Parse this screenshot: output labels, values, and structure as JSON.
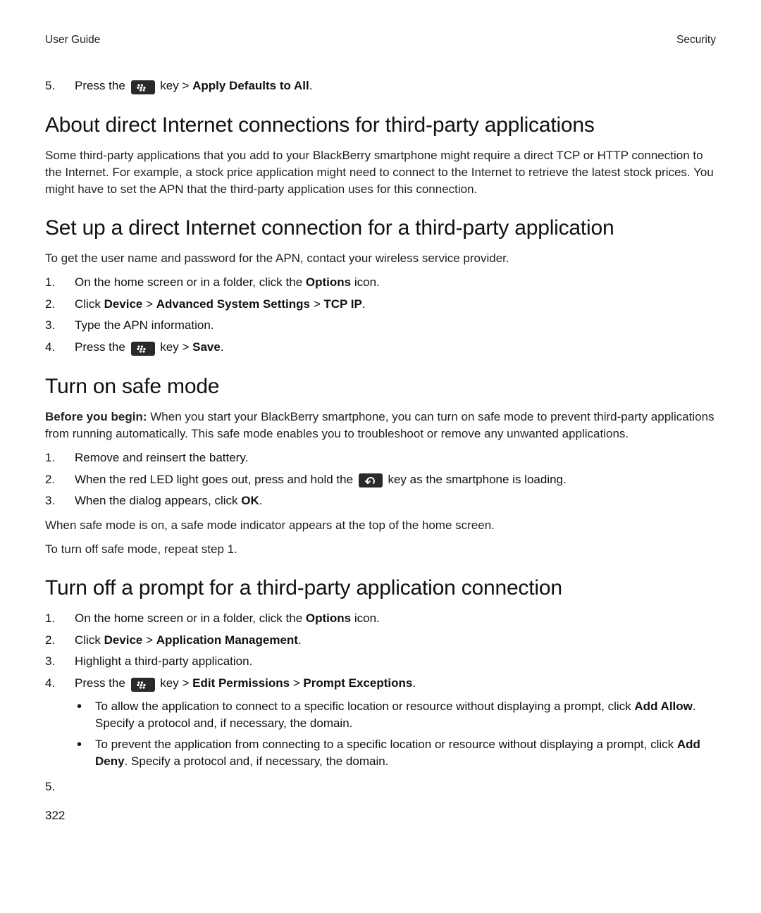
{
  "header": {
    "left": "User Guide",
    "right": "Security"
  },
  "top_step": {
    "num": "5.",
    "pre": "Press the ",
    "post_key": " key > ",
    "bold_tail": "Apply Defaults to All",
    "period": "."
  },
  "sec1": {
    "title": "About direct Internet connections for third-party applications",
    "p": "Some third-party applications that you add to your BlackBerry smartphone might require a direct TCP or HTTP connection to the Internet. For example, a stock price application might need to connect to the Internet to retrieve the latest stock prices. You might have to set the APN that the third-party application uses for this connection."
  },
  "sec2": {
    "title": "Set up a direct Internet connection for a third-party application",
    "intro": "To get the user name and password for the APN, contact your wireless service provider.",
    "steps": [
      {
        "num": "1.",
        "parts": [
          {
            "t": "On the home screen or in a folder, click the "
          },
          {
            "t": "Options",
            "bold": true
          },
          {
            "t": " icon."
          }
        ]
      },
      {
        "num": "2.",
        "parts": [
          {
            "t": "Click "
          },
          {
            "t": "Device",
            "bold": true
          },
          {
            "t": " > "
          },
          {
            "t": "Advanced System Settings",
            "bold": true
          },
          {
            "t": " > "
          },
          {
            "t": "TCP IP",
            "bold": true
          },
          {
            "t": "."
          }
        ]
      },
      {
        "num": "3.",
        "parts": [
          {
            "t": "Type the APN information."
          }
        ]
      },
      {
        "num": "4.",
        "parts": [
          {
            "t": "Press the "
          },
          {
            "icon": "menu"
          },
          {
            "t": " key > "
          },
          {
            "t": "Save",
            "bold": true
          },
          {
            "t": "."
          }
        ]
      }
    ]
  },
  "sec3": {
    "title": "Turn on safe mode",
    "before_label": "Before you begin:",
    "before_text": " When you start your BlackBerry smartphone, you can turn on safe mode to prevent third-party applications from running automatically. This safe mode enables you to troubleshoot or remove any unwanted applications.",
    "steps": [
      {
        "num": "1.",
        "parts": [
          {
            "t": "Remove and reinsert the battery."
          }
        ]
      },
      {
        "num": "2.",
        "parts": [
          {
            "t": "When the red LED light goes out, press and hold the "
          },
          {
            "icon": "back"
          },
          {
            "t": " key as the smartphone is loading."
          }
        ]
      },
      {
        "num": "3.",
        "parts": [
          {
            "t": "When the dialog appears, click "
          },
          {
            "t": "OK",
            "bold": true
          },
          {
            "t": "."
          }
        ]
      }
    ],
    "p1": "When safe mode is on, a safe mode indicator appears at the top of the home screen.",
    "p2": "To turn off safe mode, repeat step 1."
  },
  "sec4": {
    "title": "Turn off a prompt for a third-party application connection",
    "steps": [
      {
        "num": "1.",
        "parts": [
          {
            "t": "On the home screen or in a folder, click the "
          },
          {
            "t": "Options",
            "bold": true
          },
          {
            "t": " icon."
          }
        ]
      },
      {
        "num": "2.",
        "parts": [
          {
            "t": "Click "
          },
          {
            "t": "Device",
            "bold": true
          },
          {
            "t": " > "
          },
          {
            "t": "Application Management",
            "bold": true
          },
          {
            "t": "."
          }
        ]
      },
      {
        "num": "3.",
        "parts": [
          {
            "t": "Highlight a third-party application."
          }
        ]
      },
      {
        "num": "4.",
        "parts": [
          {
            "t": "Press the "
          },
          {
            "icon": "menu"
          },
          {
            "t": " key > "
          },
          {
            "t": "Edit Permissions",
            "bold": true
          },
          {
            "t": " > "
          },
          {
            "t": "Prompt Exceptions",
            "bold": true
          },
          {
            "t": "."
          }
        ],
        "sub": [
          {
            "parts": [
              {
                "t": "To allow the application to connect to a specific location or resource without displaying a prompt, click "
              },
              {
                "t": "Add Allow",
                "bold": true
              },
              {
                "t": ". Specify a protocol and, if necessary, the domain."
              }
            ]
          },
          {
            "parts": [
              {
                "t": "To prevent the application from connecting to a specific location or resource without displaying a prompt, click "
              },
              {
                "t": "Add Deny",
                "bold": true
              },
              {
                "t": ". Specify a protocol and, if necessary, the domain."
              }
            ]
          }
        ]
      },
      {
        "num": "5.",
        "parts": []
      }
    ]
  },
  "page_number": "322"
}
